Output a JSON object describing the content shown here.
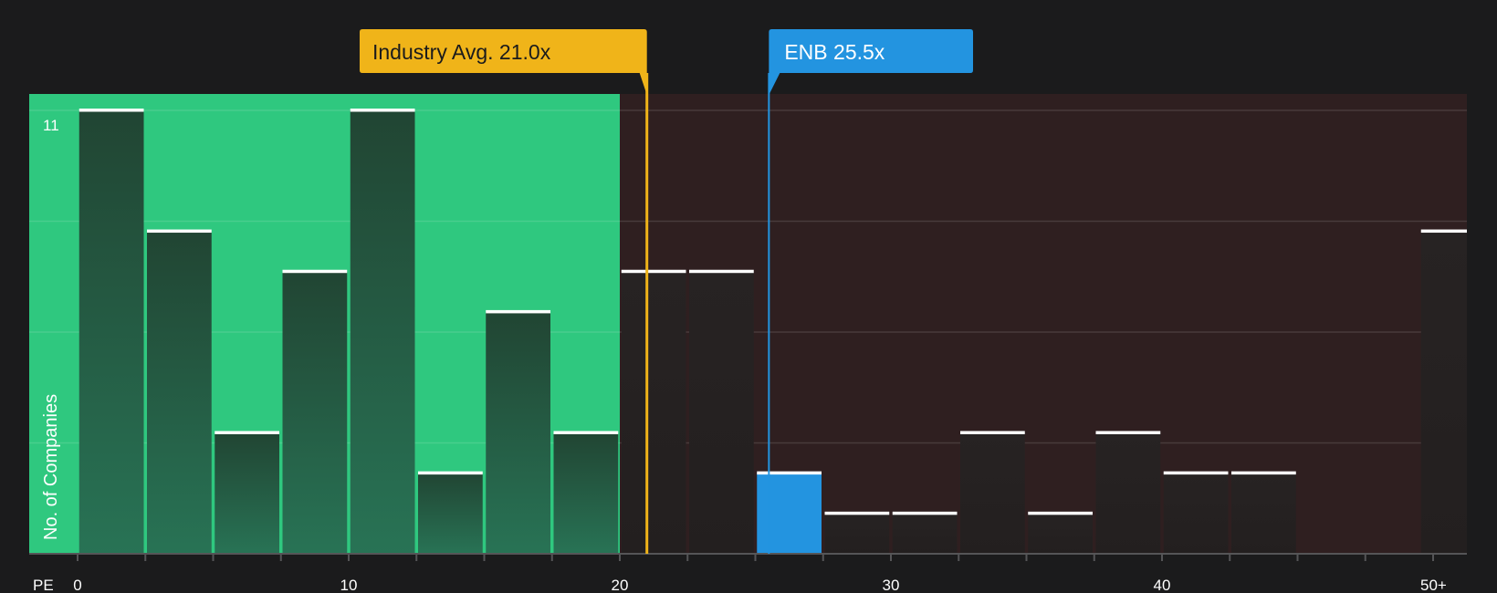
{
  "chart_data": {
    "type": "bar",
    "xlabel": "PE",
    "ylabel": "No. of Companies",
    "ymax_label": "11",
    "ylim": [
      0,
      11
    ],
    "xlim": [
      0,
      51.5
    ],
    "bin_width": 2.5,
    "x_ticks": [
      {
        "value": 0,
        "label": "0"
      },
      {
        "value": 10,
        "label": "10"
      },
      {
        "value": 20,
        "label": "20"
      },
      {
        "value": 30,
        "label": "30"
      },
      {
        "value": 40,
        "label": "40"
      },
      {
        "value": 50,
        "label": "50+"
      }
    ],
    "bins": [
      {
        "start": 0,
        "value": 11
      },
      {
        "start": 2.5,
        "value": 8
      },
      {
        "start": 5,
        "value": 3
      },
      {
        "start": 7.5,
        "value": 7
      },
      {
        "start": 10,
        "value": 11
      },
      {
        "start": 12.5,
        "value": 2
      },
      {
        "start": 15,
        "value": 6
      },
      {
        "start": 17.5,
        "value": 3
      },
      {
        "start": 20,
        "value": 7
      },
      {
        "start": 22.5,
        "value": 7
      },
      {
        "start": 25,
        "value": 2,
        "highlight": true
      },
      {
        "start": 27.5,
        "value": 1
      },
      {
        "start": 30,
        "value": 1
      },
      {
        "start": 32.5,
        "value": 3
      },
      {
        "start": 35,
        "value": 1
      },
      {
        "start": 37.5,
        "value": 3
      },
      {
        "start": 40,
        "value": 2
      },
      {
        "start": 42.5,
        "value": 2
      },
      {
        "start": 50,
        "value": 8
      }
    ],
    "fair_region_end": 20,
    "industry_avg": {
      "value": 21.0,
      "label": "Industry Avg. 21.0x"
    },
    "company": {
      "value": 25.5,
      "label": "ENB 25.5x"
    },
    "colors": {
      "background": "#1b1b1c",
      "fair_region": "#2fc87f",
      "expensive_region": "#2f1f20",
      "bar_in_fair": "#235035",
      "bar_in_expensive": "#252121",
      "highlight": "#2394e0",
      "industry": "#f0b419",
      "bar_cap": "#ffffff"
    }
  }
}
